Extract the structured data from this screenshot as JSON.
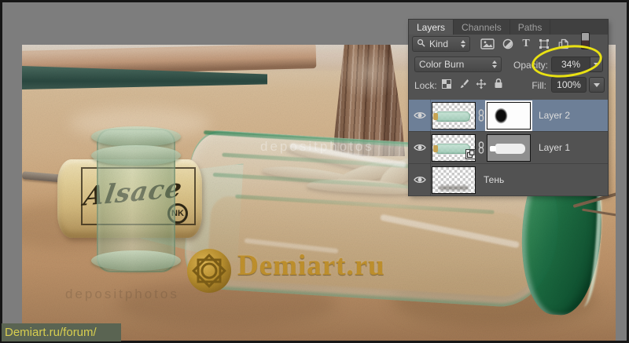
{
  "panel": {
    "tabs": [
      {
        "label": "Layers",
        "active": true
      },
      {
        "label": "Channels",
        "active": false
      },
      {
        "label": "Paths",
        "active": false
      }
    ],
    "filter_row": {
      "kind": "Kind",
      "type_icon_glyph": "T"
    },
    "blend_row": {
      "mode": "Color Burn",
      "opacity_label": "Opacity:",
      "opacity_value": "34%"
    },
    "lock_row": {
      "lock_label": "Lock:",
      "fill_label": "Fill:",
      "fill_value": "100%"
    },
    "layers": [
      {
        "name": "Layer 2",
        "selected": true,
        "has_mask": true
      },
      {
        "name": "Layer 1",
        "selected": false,
        "has_mask": true
      },
      {
        "name": "Тень",
        "selected": false,
        "has_mask": false
      }
    ]
  },
  "photo": {
    "cork_text": "Alsace",
    "cork_monogram": "NK",
    "watermark": "Demiart.ru",
    "stock_watermark": "depositphotos"
  },
  "footer": {
    "link": "Demiart.ru/forum/"
  },
  "colors": {
    "annotation_yellow": "#e9e113",
    "selected_layer_blue": "#6d7f97",
    "watermark_gold": "#c2922d",
    "canvas_gray": "#7d7d7d"
  }
}
